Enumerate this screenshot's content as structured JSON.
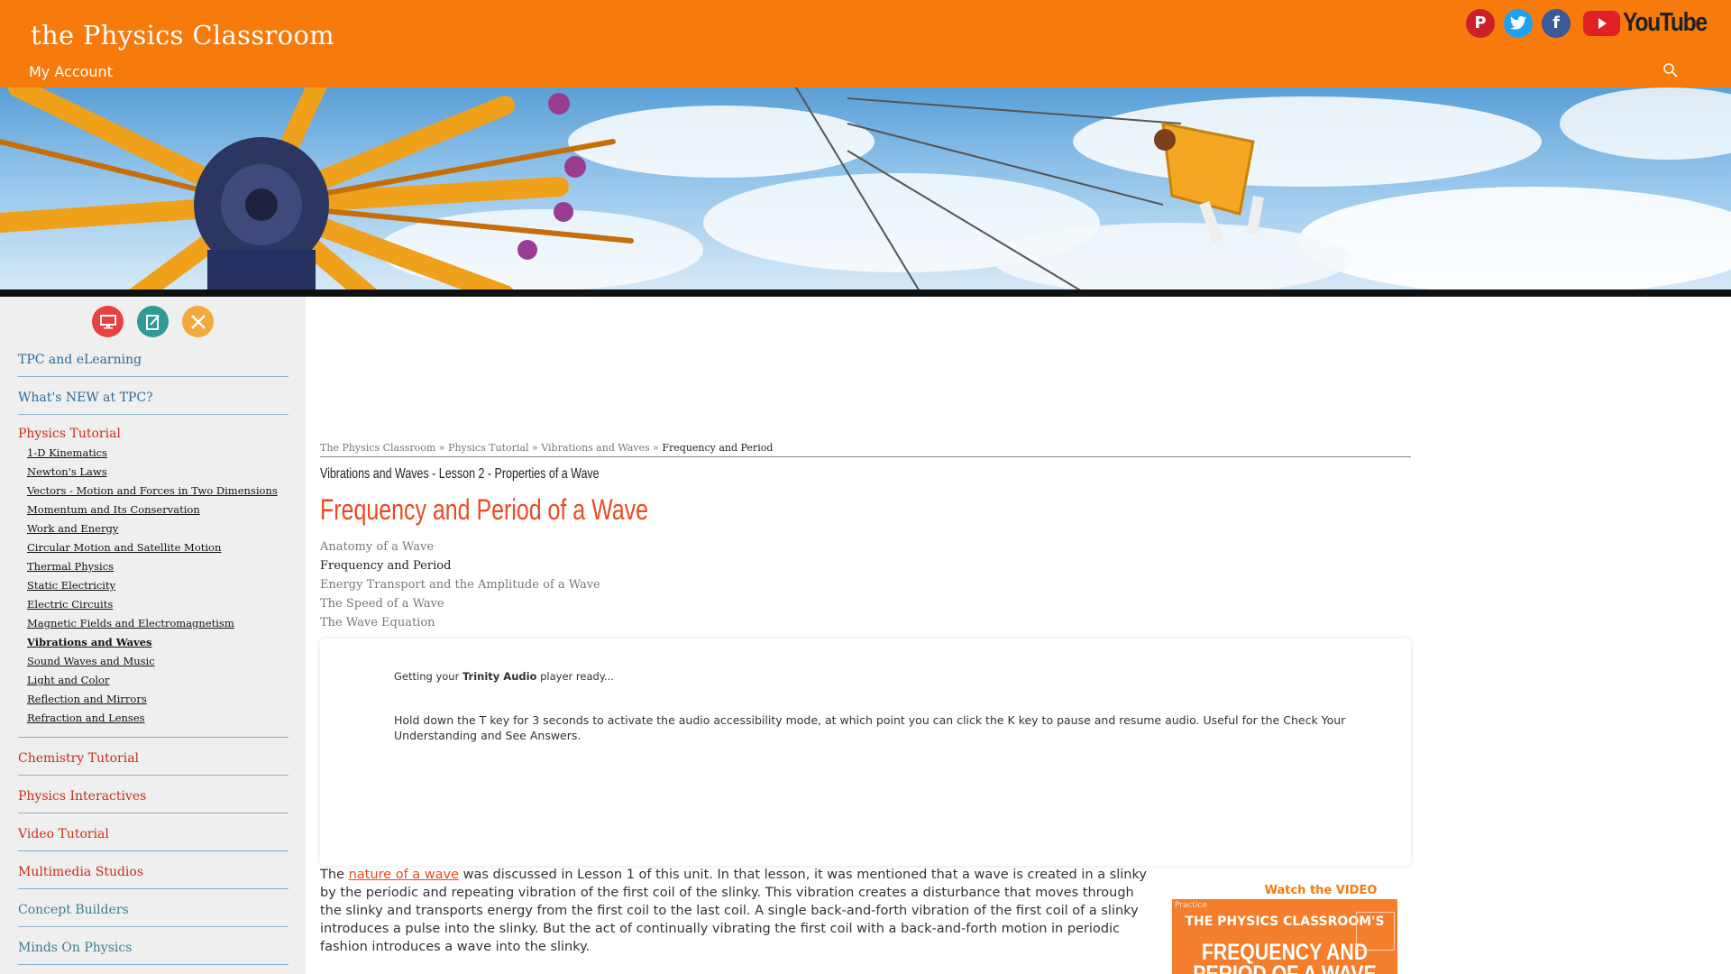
{
  "header": {
    "site_title": "the Physics Classroom",
    "my_account": "My Account",
    "social": [
      {
        "name": "pinterest-icon",
        "glyph": "P",
        "color": "#cb2027"
      },
      {
        "name": "twitter-icon",
        "glyph": "t",
        "color": "#1da1f2"
      },
      {
        "name": "facebook-icon",
        "glyph": "f",
        "color": "#3b5998"
      }
    ],
    "youtube_label": "YouTube",
    "colors": {
      "header": "#f77a0d",
      "accent": "#ea4a23"
    }
  },
  "sidebar": {
    "nav_tpc": "TPC and eLearning",
    "nav_new": "What's NEW at TPC?",
    "nav_physics_tutorial": "Physics Tutorial",
    "tutorial_items": [
      "1-D Kinematics",
      "Newton's Laws",
      "Vectors - Motion and Forces in Two Dimensions",
      "Momentum and Its Conservation",
      "Work and Energy",
      "Circular Motion and Satellite Motion",
      "Thermal Physics",
      "Static Electricity",
      "Electric Circuits",
      "Magnetic Fields and Electromagnetism",
      "Vibrations and Waves",
      "Sound Waves and Music",
      "Light and Color",
      "Reflection and Mirrors",
      "Refraction and Lenses"
    ],
    "active_item": "Vibrations and Waves",
    "nav_chemistry": "Chemistry Tutorial",
    "nav_interactives": "Physics Interactives",
    "nav_video": "Video Tutorial",
    "nav_multimedia": "Multimedia Studios",
    "nav_concept": "Concept Builders",
    "nav_minds": "Minds On Physics"
  },
  "breadcrumb": {
    "item1": "The Physics Classroom",
    "item2": "Physics Tutorial",
    "item3": "Vibrations and Waves",
    "current": "Frequency and Period",
    "sep": " » "
  },
  "lesson_heading": "Vibrations and Waves - Lesson 2 - Properties of a Wave",
  "page_title": "Frequency and Period of a Wave",
  "subtopics": [
    "Anatomy of a Wave",
    "Frequency and Period",
    "Energy Transport and the Amplitude of a Wave",
    "The Speed of a Wave",
    "The Wave Equation"
  ],
  "audio": {
    "ready_prefix": "Getting your ",
    "ready_brand": "Trinity Audio",
    "ready_suffix": " player ready...",
    "note": "Hold down the T key for 3 seconds to activate the audio accessibility mode, at which point you can click the K key to pause and resume audio. Useful for the Check Your Understanding and See Answers."
  },
  "body": {
    "text_start": "The ",
    "link_text": "nature of a wave",
    "text_rest": " was discussed in Lesson 1 of this unit. In that lesson, it was mentioned that a wave is created in a slinky by the periodic and repeating vibration of the first coil of the slinky. This vibration creates a disturbance that moves through the slinky and transports energy from the first coil to the last coil. A single back-and-forth vibration of the first coil of a slinky introduces a pulse into the slinky. But the act of continually vibrating the first coil with a back-and-forth motion in periodic fashion introduces a wave into the slinky."
  },
  "video": {
    "label": "Watch the VIDEO",
    "thumb_practice": "Practice",
    "thumb_line1": "THE PHYSICS CLASSROOM'S",
    "thumb_line2": "FREQUENCY AND PERIOD OF A WAVE"
  }
}
